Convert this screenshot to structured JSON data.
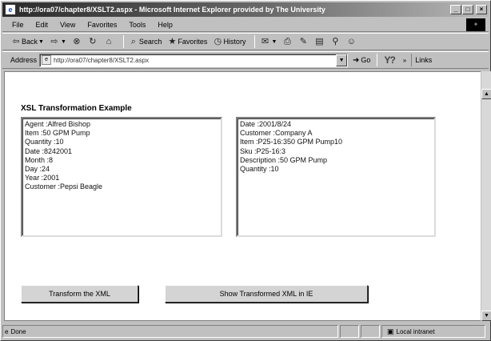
{
  "window": {
    "title": "http://ora07/chapter8/XSLT2.aspx - Microsoft Internet Explorer provided by The University",
    "min_label": "_",
    "max_label": "□",
    "close_label": "×"
  },
  "menubar": {
    "items": [
      "File",
      "Edit",
      "View",
      "Favorites",
      "Tools",
      "Help"
    ]
  },
  "toolbar": {
    "back_label": "Back",
    "search_label": "Search",
    "favorites_label": "Favorites",
    "history_label": "History"
  },
  "addressbar": {
    "label": "Address",
    "url": "http://ora07/chapter8/XSLT2.aspx",
    "go_label": "Go",
    "links_label": "Links"
  },
  "page": {
    "title": "XSL Transformation Example",
    "left_box_lines": [
      "Agent :Alfred Bishop",
      "Item :50 GPM Pump",
      "Quantity :10",
      "Date :8242001",
      "Month :8",
      "Day :24",
      "Year :2001",
      "Customer :Pepsi Beagle"
    ],
    "right_box_lines": [
      "Date :2001/8/24",
      "Customer :Company A",
      "Item :P25-16:350 GPM Pump10",
      "Sku :P25-16:3",
      "Description :50 GPM Pump",
      "Quantity :10"
    ],
    "transform_button": "Transform the XML",
    "show_button": "Show Transformed XML in IE"
  },
  "statusbar": {
    "status_text": "Done",
    "zone_text": "Local intranet"
  },
  "icons": {
    "back": "back-arrow-icon",
    "forward": "forward-arrow-icon",
    "stop": "stop-icon",
    "refresh": "refresh-icon",
    "home": "home-icon",
    "search": "search-icon",
    "favorites": "favorites-icon",
    "history": "history-icon",
    "mail": "mail-icon",
    "print": "print-icon",
    "edit": "edit-icon",
    "discuss": "discuss-icon",
    "messenger": "messenger-icon"
  }
}
